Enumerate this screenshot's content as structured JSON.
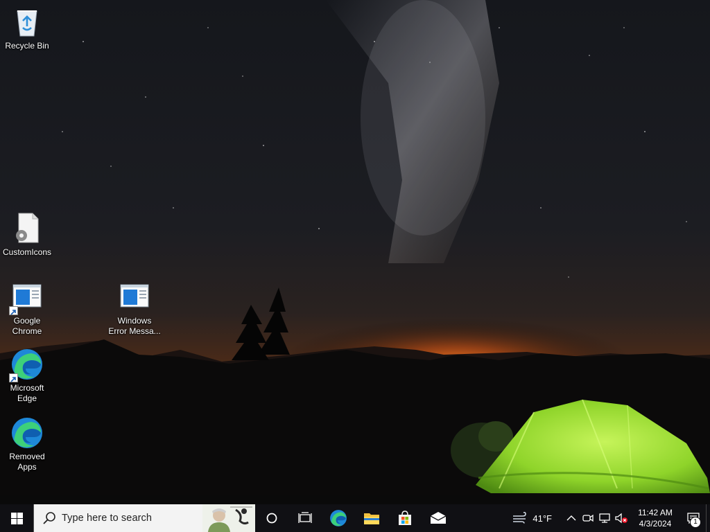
{
  "desktop": {
    "icons": [
      {
        "label": "Recycle Bin",
        "icon": "recycle-bin-icon"
      },
      {
        "label": "CustomIcons",
        "icon": "file-settings-icon"
      },
      {
        "label": "Google Chrome",
        "icon": "window-app-icon",
        "shortcut": true
      },
      {
        "label": "Windows Error Messa...",
        "icon": "window-app-icon"
      },
      {
        "label": "Microsoft Edge",
        "icon": "edge-icon",
        "shortcut": true
      },
      {
        "label": "Removed Apps",
        "icon": "edge-icon"
      }
    ]
  },
  "taskbar": {
    "start_icon": "windows-logo-icon",
    "search": {
      "placeholder": "Type here to search",
      "icon": "search-icon"
    },
    "pinned": [
      {
        "name": "cortana",
        "icon": "circle-icon"
      },
      {
        "name": "task-view",
        "icon": "task-view-icon"
      },
      {
        "name": "microsoft-edge",
        "icon": "edge-icon"
      },
      {
        "name": "file-explorer",
        "icon": "folder-icon"
      },
      {
        "name": "microsoft-store",
        "icon": "store-bag-icon"
      },
      {
        "name": "mail",
        "icon": "mail-icon"
      }
    ],
    "tray": {
      "weather_temp": "41°F",
      "weather_icon": "wind-icon",
      "time": "11:42 AM",
      "date": "4/3/2024",
      "notification_count": "1"
    }
  },
  "colors": {
    "taskbar_bg": "#101014",
    "search_bg": "#f3f3f3",
    "tent_green": "#9be22a",
    "horizon_orange": "#e06a1e",
    "edge_blue": "#1e88d8",
    "edge_green": "#3dd07a"
  }
}
